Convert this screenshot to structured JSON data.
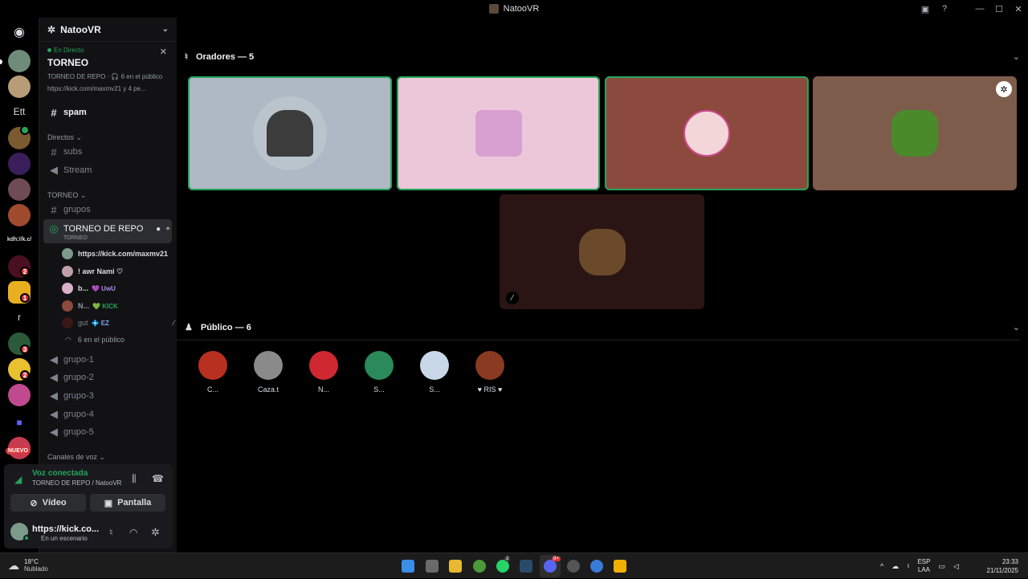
{
  "window": {
    "title": "NatooVR"
  },
  "rail": {
    "label_ett": "Ett",
    "label_kick": "kdh://k.c/",
    "label_r": "r",
    "new_badge": "NUEVO",
    "badges": [
      "2",
      "1",
      "3",
      "2",
      "2"
    ]
  },
  "sidebar": {
    "server_name": "NatooVR",
    "live": {
      "tag": "En Directo",
      "title": "TORNEO",
      "info": "TORNEO DE REPO · 🎧 6 en el público",
      "link": "https://kick.com/maxmv21 y 4 pe..."
    },
    "channels": {
      "spam": "spam",
      "directos_cat": "Directos ⌄",
      "subs": "subs",
      "stream": "Stream",
      "torneo_cat": "TORNEO ⌄",
      "grupos": "grupos",
      "stage": "TORNEO DE REPO",
      "stage_sub": "TORNEO",
      "audience": "6 en el público",
      "grupo1": "grupo-1",
      "grupo2": "grupo-2",
      "grupo3": "grupo-3",
      "grupo4": "grupo-4",
      "grupo5": "grupo-5",
      "voice_cat": "Canales de voz ⌄"
    },
    "stage_users": [
      {
        "name": "https://kick.com/maxmv21",
        "tag": ""
      },
      {
        "name": "! awr Nami ♡",
        "tag": ""
      },
      {
        "name": "b...",
        "tag": "💜 UwU"
      },
      {
        "name": "N...",
        "tag": "💚 KICK"
      },
      {
        "name": "gut",
        "tag": "💠 EZ"
      }
    ]
  },
  "voice_panel": {
    "status": "Voz conectada",
    "location": "TORNEO DE REPO / NatooVR",
    "video_label": "Vídeo",
    "screen_label": "Pantalla",
    "user_name": "https://kick.co...",
    "user_status": "En un escenario"
  },
  "main": {
    "speakers_header": "Oradores — 5",
    "audience_header": "Público — 6",
    "audience": [
      {
        "name": "C..."
      },
      {
        "name": "Caza.t"
      },
      {
        "name": "N..."
      },
      {
        "name": "S..."
      },
      {
        "name": "S..."
      },
      {
        "name": "♥ RIS ♥"
      }
    ]
  },
  "taskbar": {
    "weather_temp": "18°C",
    "weather_desc": "Nublado",
    "lang1": "ESP",
    "lang2": "LAA",
    "time": "23:33",
    "date": "21/11/2025",
    "whatsapp_badge": "2",
    "discord_badge": "9+"
  },
  "colors": {
    "accent_green": "#23a55a",
    "sidebar_bg": "#121214",
    "tile1": "#aeb9c3",
    "tile2": "#ecc7da",
    "tile3": "#8c4a3e",
    "tile4": "#7d5c4b",
    "tile5": "#2b1414"
  }
}
